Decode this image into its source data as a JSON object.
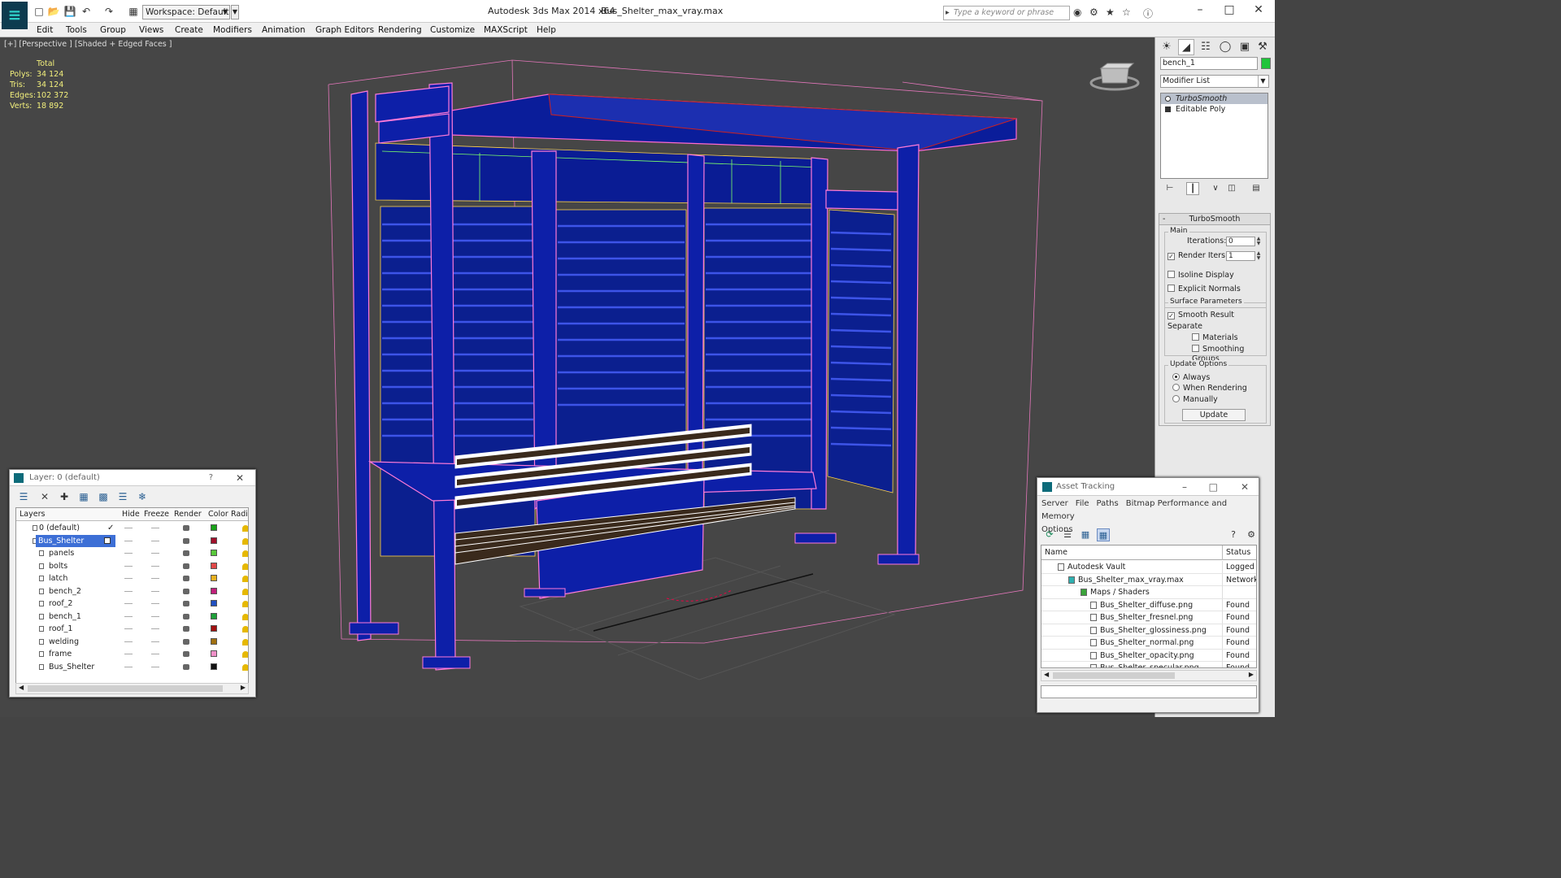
{
  "titlebar": {
    "workspace": "Workspace: Default",
    "app_title": "Autodesk 3ds Max  2014 x64",
    "file_title": "Bus_Shelter_max_vray.max",
    "search_placeholder": "Type a keyword or phrase"
  },
  "menubar": {
    "items": [
      "Edit",
      "Tools",
      "Group",
      "Views",
      "Create",
      "Modifiers",
      "Animation",
      "Graph Editors",
      "Rendering",
      "Customize",
      "MAXScript",
      "Help"
    ]
  },
  "viewport": {
    "label": "[+] [Perspective ] [Shaded + Edged Faces ]",
    "stats": {
      "header": "Total",
      "rows": [
        {
          "label": "Polys:",
          "value": "34 124"
        },
        {
          "label": "Tris:",
          "value": "34 124"
        },
        {
          "label": "Edges:",
          "value": "102 372"
        },
        {
          "label": "Verts:",
          "value": "18 892"
        }
      ]
    }
  },
  "command_panel": {
    "object_name": "bench_1",
    "object_color": "#1fc43a",
    "modifier_list": "Modifier List",
    "stack": [
      "TurboSmooth",
      "Editable Poly"
    ],
    "rollout_title": "TurboSmooth",
    "main_label": "Main",
    "iterations_label": "Iterations:",
    "iterations_value": "0",
    "render_iters_label": "Render Iters:",
    "render_iters_value": "1",
    "isoline_label": "Isoline Display",
    "explicit_normals_label": "Explicit Normals",
    "surface_label": "Surface Parameters",
    "smooth_result_label": "Smooth Result",
    "separate_label": "Separate",
    "materials_label": "Materials",
    "smoothing_groups_label": "Smoothing Groups",
    "update_options_label": "Update Options",
    "always_label": "Always",
    "when_rendering_label": "When Rendering",
    "manually_label": "Manually",
    "update_button": "Update"
  },
  "layer_window": {
    "title": "Layer: 0 (default)",
    "help": "?",
    "columns": [
      "Layers",
      "Hide",
      "Freeze",
      "Render",
      "Color",
      "Radio"
    ],
    "layers": [
      {
        "name": "0 (default)",
        "color": "#1aa31a"
      },
      {
        "name": "Bus_Shelter",
        "color": "#a0102a"
      },
      {
        "name": "panels",
        "color": "#58c83a"
      },
      {
        "name": "bolts",
        "color": "#e04848"
      },
      {
        "name": "latch",
        "color": "#e8b020"
      },
      {
        "name": "bench_2",
        "color": "#c0207a"
      },
      {
        "name": "roof_2",
        "color": "#2050c0"
      },
      {
        "name": "bench_1",
        "color": "#1fa03a"
      },
      {
        "name": "roof_1",
        "color": "#a01010"
      },
      {
        "name": "welding",
        "color": "#a07010"
      },
      {
        "name": "frame",
        "color": "#f090c8"
      },
      {
        "name": "Bus_Shelter",
        "color": "#111111"
      }
    ]
  },
  "asset_window": {
    "title": "Asset Tracking",
    "menu": [
      "Server",
      "File",
      "Paths",
      "Bitmap Performance and Memory"
    ],
    "menu2": "Options",
    "columns": [
      "Name",
      "Status"
    ],
    "rows": [
      {
        "name": "Autodesk Vault",
        "status": "Logged Out"
      },
      {
        "name": "Bus_Shelter_max_vray.max",
        "status": "Network"
      },
      {
        "name": "Maps / Shaders",
        "status": ""
      },
      {
        "name": "Bus_Shelter_diffuse.png",
        "status": "Found"
      },
      {
        "name": "Bus_Shelter_fresnel.png",
        "status": "Found"
      },
      {
        "name": "Bus_Shelter_glossiness.png",
        "status": "Found"
      },
      {
        "name": "Bus_Shelter_normal.png",
        "status": "Found"
      },
      {
        "name": "Bus_Shelter_opacity.png",
        "status": "Found"
      },
      {
        "name": "Bus_Shelter_specular.png",
        "status": "Found"
      }
    ]
  }
}
